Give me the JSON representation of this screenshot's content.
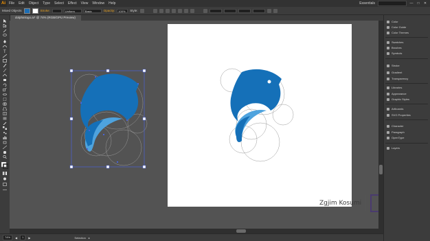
{
  "menubar": {
    "logo": "Ai",
    "items": [
      "File",
      "Edit",
      "Object",
      "Type",
      "Select",
      "Effect",
      "View",
      "Window",
      "Help"
    ],
    "workspace": "Essentials",
    "window_buttons": [
      "—",
      "□",
      "✕"
    ]
  },
  "controlbar": {
    "selection_label": "Mixed Objects",
    "stroke_label": "Stroke:",
    "uniform_label": "Uniform",
    "basic_label": "Basic",
    "opacity_label": "Opacity:",
    "opacity_value": "100%",
    "style_label": "Style:",
    "colors": {
      "fill": "#1b6db5",
      "stroke": "#ffffff",
      "accent": "#e6a020"
    }
  },
  "document": {
    "tab_label": "dolphinlogo.ai* @ 74% (RGB/GPU Preview)"
  },
  "artwork": {
    "colors": {
      "dark_blue": "#1570b8",
      "light_blue": "#4ea3de",
      "eye": "#ffffff",
      "guide": "#9a9a9a",
      "selection": "#4a63d8"
    }
  },
  "panels": [
    {
      "label": "Color",
      "icon": "color-icon"
    },
    {
      "label": "Color Guide",
      "icon": "color-guide-icon"
    },
    {
      "label": "Color Themes",
      "icon": "color-themes-icon"
    },
    {
      "label": "Swatches",
      "icon": "swatches-icon"
    },
    {
      "label": "Brushes",
      "icon": "brushes-icon"
    },
    {
      "label": "Symbols",
      "icon": "symbols-icon"
    },
    {
      "label": "Stroke",
      "icon": "stroke-icon"
    },
    {
      "label": "Gradient",
      "icon": "gradient-icon"
    },
    {
      "label": "Transparency",
      "icon": "transparency-icon"
    },
    {
      "label": "Libraries",
      "icon": "libraries-icon"
    },
    {
      "label": "Appearance",
      "icon": "appearance-icon"
    },
    {
      "label": "Graphic Styles",
      "icon": "graphic-styles-icon"
    },
    {
      "label": "Artboards",
      "icon": "artboards-icon"
    },
    {
      "label": "SVG Properties",
      "icon": "svg-properties-icon"
    },
    {
      "label": "Character",
      "icon": "character-icon"
    },
    {
      "label": "Paragraph",
      "icon": "paragraph-icon"
    },
    {
      "label": "OpenType",
      "icon": "opentype-icon"
    },
    {
      "label": "Layers",
      "icon": "layers-icon"
    }
  ],
  "statusbar": {
    "zoom": "74%",
    "artboard_num": "1",
    "tool_name": "Selection"
  },
  "watermark": {
    "name": "Zgjim Kosumi",
    "brand": "rise"
  }
}
